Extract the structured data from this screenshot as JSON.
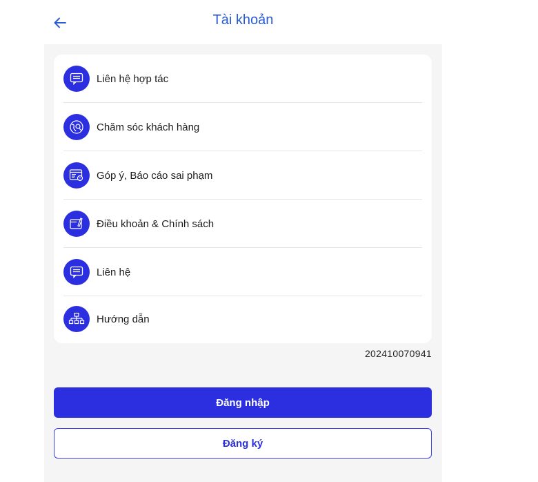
{
  "header": {
    "back_icon": "arrow-left-icon",
    "title": "Tài khoản"
  },
  "menu": {
    "items": [
      {
        "label": "Liên hệ hợp tác",
        "icon": "chat-bubble-icon"
      },
      {
        "label": "Chăm sóc khách hàng",
        "icon": "customer-care-icon"
      },
      {
        "label": "Góp ý, Báo cáo sai phạm",
        "icon": "feedback-report-icon"
      },
      {
        "label": "Điều khoản & Chính sách",
        "icon": "terms-policy-icon"
      },
      {
        "label": "Liên hệ",
        "icon": "chat-bubble-icon"
      },
      {
        "label": "Hướng dẫn",
        "icon": "sitemap-icon"
      }
    ]
  },
  "version": "202410070941",
  "actions": {
    "login_label": "Đăng nhập",
    "register_label": "Đăng ký"
  },
  "colors": {
    "primary": "#2b2fe0",
    "title": "#2a5cd6",
    "background": "#f5f5f6"
  }
}
